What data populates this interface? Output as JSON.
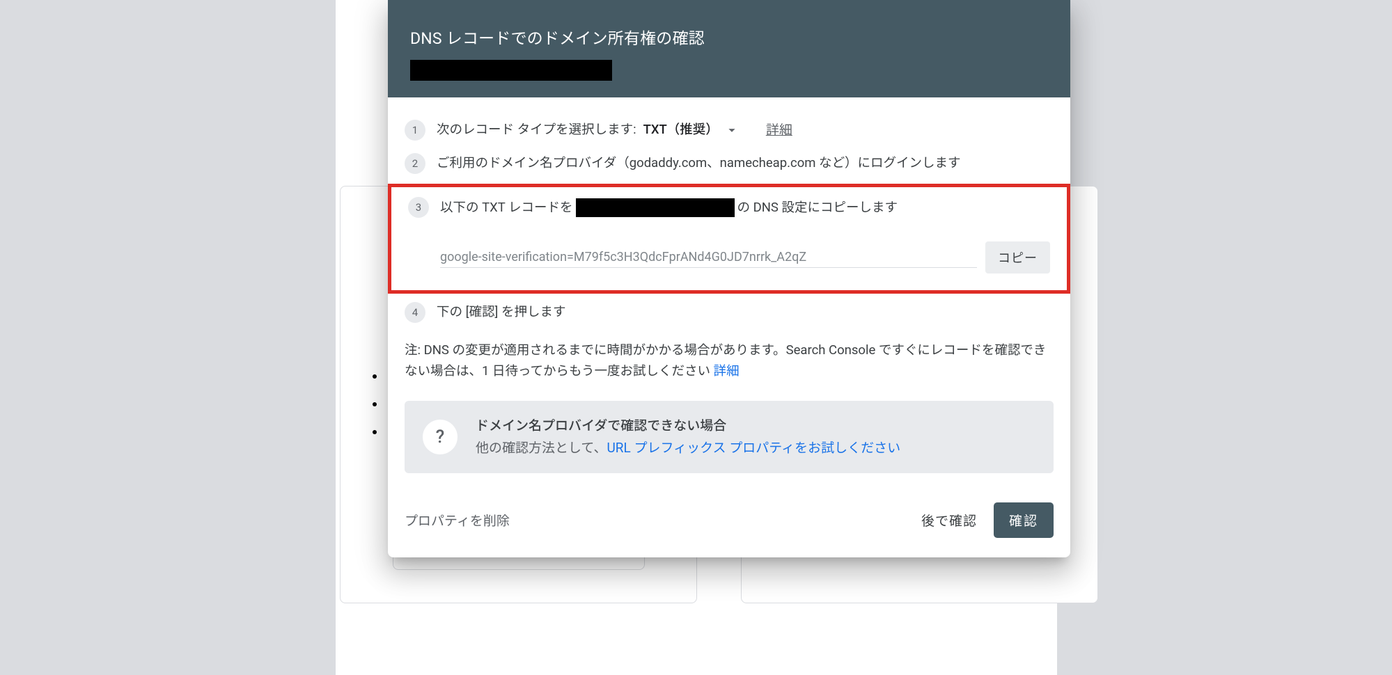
{
  "dialog": {
    "title": "DNS レコードでのドメイン所有権の確認",
    "step1_label": "次のレコード タイプを選択します:",
    "record_type": "TXT（推奨）",
    "details_label": "詳細",
    "step2_text": "ご利用のドメイン名プロバイダ（godaddy.com、namecheap.com など）にログインします",
    "step3_prefix": "以下の TXT レコードを",
    "step3_suffix": "の DNS 設定にコピーします",
    "txt_value": "google-site-verification=M79f5c3H3QdcFprANd4G0JD7nrrk_A2qZ",
    "copy_label": "コピー",
    "step4_text": "下の [確認] を押します",
    "note_text": "注: DNS の変更が適用されるまでに時間がかかる場合があります。Search Console ですぐにレコードを確認できない場合は、1 日待ってからもう一度お試しください ",
    "note_link": "詳細",
    "info_title": "ドメイン名プロバイダで確認できない場合",
    "info_sub_prefix": "他の確認方法として、",
    "info_link": "URL プレフィックス プロパティをお試しください",
    "footer_delete": "プロパティを削除",
    "footer_later": "後で確認",
    "footer_confirm": "確認"
  },
  "step_numbers": {
    "s1": "1",
    "s2": "2",
    "s3": "3",
    "s4": "4"
  },
  "icons": {
    "help": "?"
  }
}
